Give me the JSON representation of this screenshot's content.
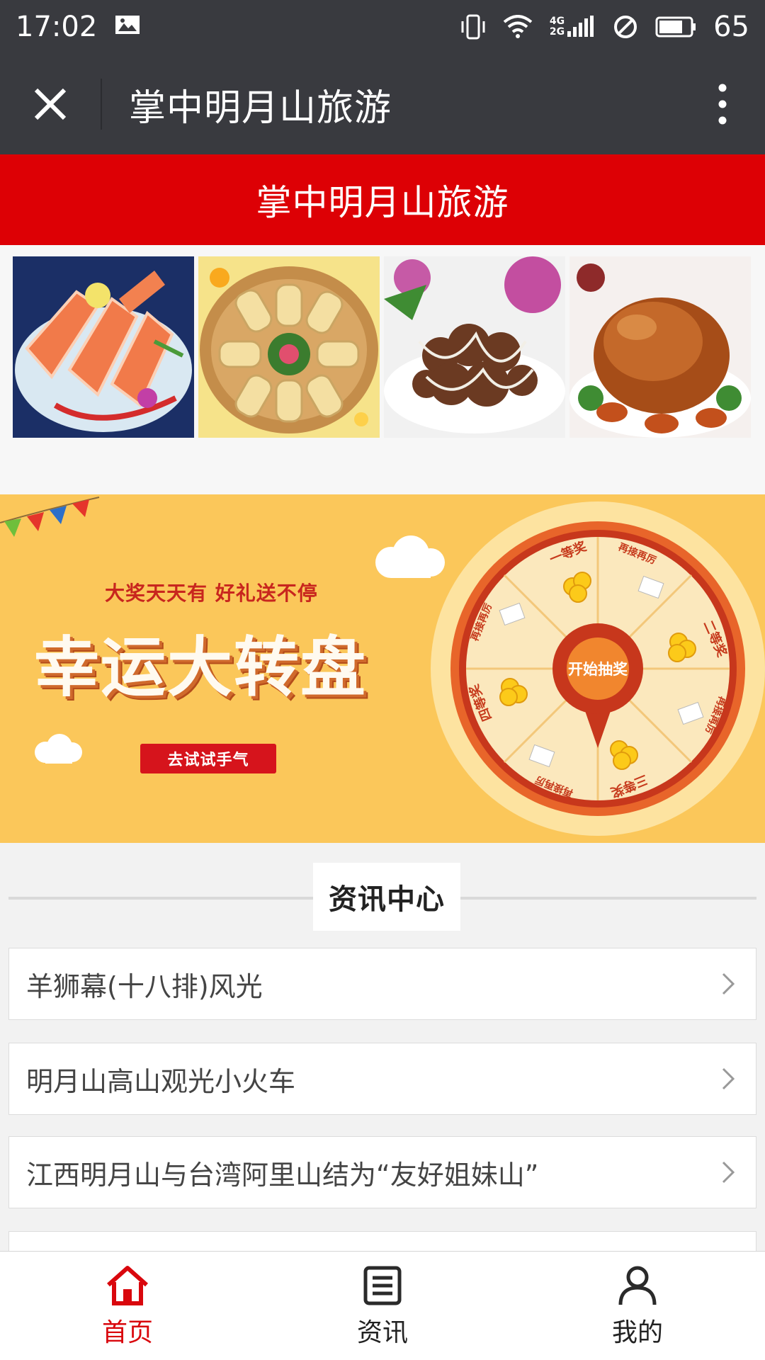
{
  "status_bar": {
    "time": "17:02",
    "battery": "65",
    "network_top": "4G",
    "network_bottom": "2G"
  },
  "title_bar": {
    "title": "掌中明月山旅游"
  },
  "header": {
    "title": "掌中明月山旅游"
  },
  "gallery": {
    "images": [
      "salmon-sashimi-image",
      "bread-basket-image",
      "fried-dish-image",
      "roast-chicken-image"
    ]
  },
  "banner": {
    "slogan": "大奖天天有 好礼送不停",
    "title": "幸运大转盘",
    "button": "去试试手气",
    "wheel": {
      "center": "开始抽奖",
      "sectors": [
        "一等奖",
        "再接再厉",
        "二等奖",
        "再接再厉",
        "三等奖",
        "再接再厉",
        "四等奖",
        "再接再厉"
      ]
    }
  },
  "news": {
    "section_title": "资讯中心",
    "items": [
      "羊狮幕(十八排)风光",
      "明月山高山观光小火车",
      "江西明月山与台湾阿里山结为“友好姐妹山”"
    ]
  },
  "bottom_nav": {
    "items": [
      {
        "label": "首页",
        "icon": "home-icon",
        "active": true
      },
      {
        "label": "资讯",
        "icon": "news-icon",
        "active": false
      },
      {
        "label": "我的",
        "icon": "user-icon",
        "active": false
      }
    ]
  },
  "colors": {
    "header_red": "#dd0005",
    "active_nav": "#d9070d",
    "banner_yellow": "#fbc75a"
  }
}
